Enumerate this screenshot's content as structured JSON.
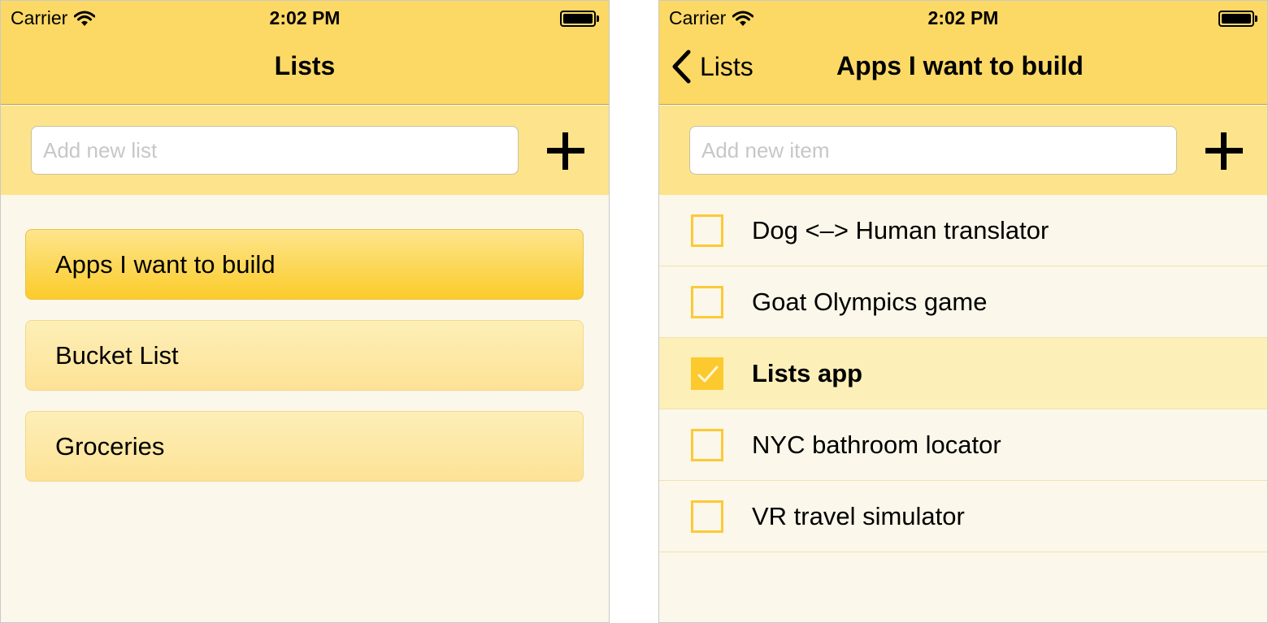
{
  "status_bar": {
    "carrier": "Carrier",
    "time": "2:02 PM"
  },
  "lists_screen": {
    "title": "Lists",
    "input_placeholder": "Add new list",
    "lists": [
      {
        "label": "Apps I want to build",
        "selected": true
      },
      {
        "label": "Bucket List",
        "selected": false
      },
      {
        "label": "Groceries",
        "selected": false
      }
    ]
  },
  "detail_screen": {
    "back_label": "Lists",
    "title": "Apps I want to build",
    "input_placeholder": "Add new item",
    "items": [
      {
        "label": "Dog <–> Human translator",
        "done": false
      },
      {
        "label": "Goat Olympics game",
        "done": false
      },
      {
        "label": "Lists app",
        "done": true
      },
      {
        "label": "NYC bathroom locator",
        "done": false
      },
      {
        "label": "VR travel simulator",
        "done": false
      }
    ]
  },
  "colors": {
    "navbar": "#fcd965",
    "input_bar": "#fde48c",
    "background": "#fbf7ea",
    "accent": "#fcca2e"
  },
  "icons": [
    "wifi-icon",
    "battery-icon",
    "plus-icon",
    "chevron-left-icon",
    "checkmark-icon"
  ]
}
